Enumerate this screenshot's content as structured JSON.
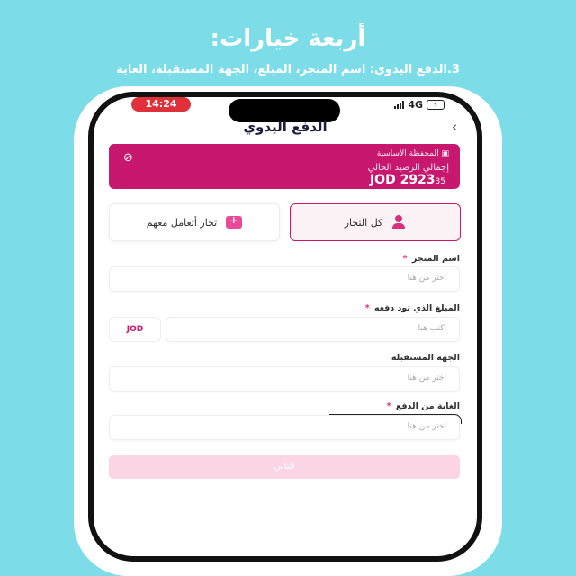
{
  "promo": {
    "headline": "أربعة خيارات:",
    "subline": "3.الدفع اليدوي: اسم المتجر، المبلغ، الجهة المستقبلة، الغاية"
  },
  "status_bar": {
    "time": "14:24",
    "network": "4G",
    "time_pill_color": "#e0313a"
  },
  "header": {
    "title": "الدفع اليدوي",
    "back_icon": "chevron-left-icon"
  },
  "wallet": {
    "label": "المحفظة الأساسية",
    "balance_label": "إجمالي الرصيد الحالي",
    "balance_main": "JOD 2923",
    "balance_decimal": "35",
    "color": "#c8176f",
    "icons": [
      "wallet-icon",
      "eye-off-icon"
    ]
  },
  "merchant_options": {
    "all": "كل التجار",
    "previous": "تجار أتعامل معهم",
    "selected": "all"
  },
  "form": {
    "store_name": {
      "label": "اسم المتجر",
      "required": "*",
      "placeholder": "اختر من هنا"
    },
    "amount": {
      "label": "المبلغ الذي تود دفعه",
      "required": "*",
      "placeholder": "اكتب هنا",
      "currency": "JOD"
    },
    "receiver": {
      "label": "الجهة المستقبلة",
      "placeholder": "اختر من هنا"
    },
    "purpose": {
      "label": "الغاية من الدفع",
      "required": "*",
      "placeholder": "اختر من هنا"
    }
  },
  "actions": {
    "next_label": "التالي"
  },
  "theme": {
    "accent": "#c8176f",
    "background": "#7cdde8",
    "button_disabled": "#fbd5e6"
  }
}
